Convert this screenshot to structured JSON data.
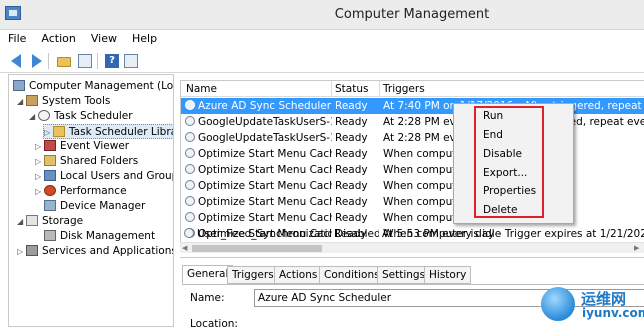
{
  "window": {
    "title": "Computer Management"
  },
  "menu": [
    "File",
    "Action",
    "View",
    "Help"
  ],
  "tree": [
    {
      "label": "Computer Management (Local",
      "icon": "computer-icon"
    },
    {
      "label": "System Tools",
      "icon": "tools-icon"
    },
    {
      "label": "Task Scheduler",
      "icon": "clock-icon"
    },
    {
      "label": "Task Scheduler Libra",
      "icon": "folder-icon"
    },
    {
      "label": "Event Viewer",
      "icon": "event-log-icon"
    },
    {
      "label": "Shared Folders",
      "icon": "shared-folder-icon"
    },
    {
      "label": "Local Users and Groups",
      "icon": "users-icon"
    },
    {
      "label": "Performance",
      "icon": "performance-icon"
    },
    {
      "label": "Device Manager",
      "icon": "device-icon"
    },
    {
      "label": "Storage",
      "icon": "storage-icon"
    },
    {
      "label": "Disk Management",
      "icon": "disk-icon"
    },
    {
      "label": "Services and Applications",
      "icon": "services-icon"
    }
  ],
  "table": {
    "columns": [
      "Name",
      "Status",
      "Triggers"
    ],
    "rows": [
      {
        "name": "Azure AD Sync Scheduler",
        "status": "Ready",
        "trigger": "At 7:40 PM on 1/17/2016 - After triggered, repeat every 03"
      },
      {
        "name": "GoogleUpdateTaskUserS-1...",
        "status": "Ready",
        "trigger": "At 2:28 PM every day - After triggered, repeat every 1 hour"
      },
      {
        "name": "GoogleUpdateTaskUserS-1...",
        "status": "Ready",
        "trigger": "At 2:28 PM every day"
      },
      {
        "name": "Optimize Start Menu Cach...",
        "status": "Ready",
        "trigger": "When computer is idle"
      },
      {
        "name": "Optimize Start Menu Cach...",
        "status": "Ready",
        "trigger": "When computer is idle"
      },
      {
        "name": "Optimize Start Menu Cach...",
        "status": "Ready",
        "trigger": "When computer is idle"
      },
      {
        "name": "Optimize Start Menu Cach...",
        "status": "Ready",
        "trigger": "When computer is idle"
      },
      {
        "name": "Optimize Start Menu Cach...",
        "status": "Ready",
        "trigger": "When computer is idle"
      },
      {
        "name": "Optimize Start Menu Cach...",
        "status": "Disabled",
        "trigger": "When computer is idle"
      },
      {
        "name": "User_Feed_Synchronizatio...",
        "status": "Ready",
        "trigger": "At 5:53 PM every day - Trigger expires at 1/21/2026 5:43:"
      }
    ]
  },
  "context_menu": [
    "Run",
    "End",
    "Disable",
    "Export...",
    "Properties",
    "Delete"
  ],
  "detail": {
    "tabs": [
      "General",
      "Triggers",
      "Actions",
      "Conditions",
      "Settings",
      "History"
    ],
    "name_label": "Name:",
    "name_value": "Azure AD Sync Scheduler",
    "location_label": "Location:"
  },
  "watermark": {
    "line1": "运维网",
    "line2": "iyunv.com"
  },
  "colors": {
    "selection": "#3399ff",
    "highlight_box": "#e0202a"
  }
}
